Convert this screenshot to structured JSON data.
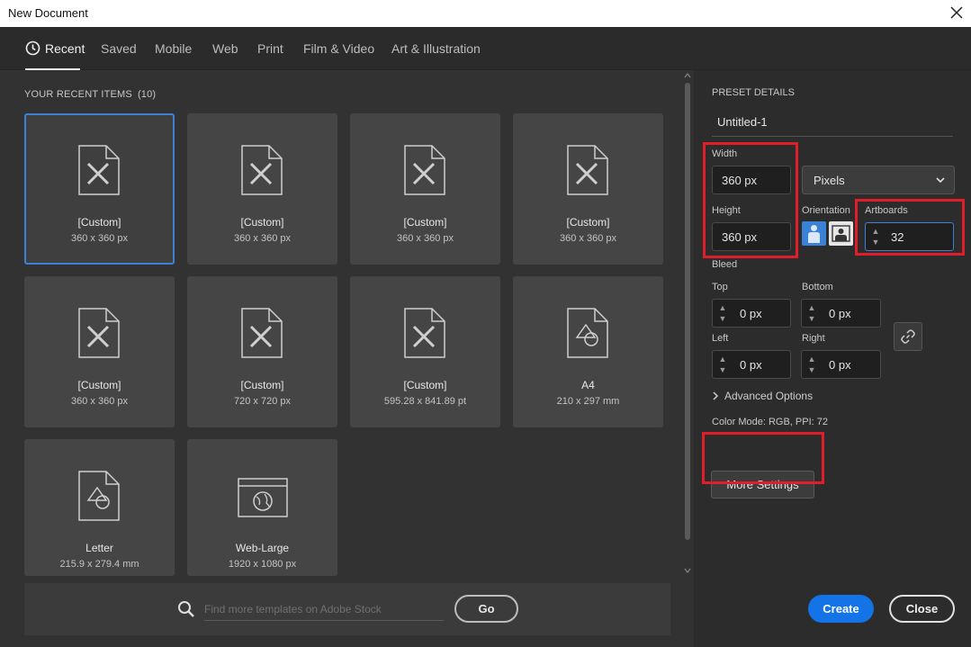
{
  "window": {
    "title": "New Document"
  },
  "tabs": [
    {
      "label": "Recent"
    },
    {
      "label": "Saved"
    },
    {
      "label": "Mobile"
    },
    {
      "label": "Web"
    },
    {
      "label": "Print"
    },
    {
      "label": "Film & Video"
    },
    {
      "label": "Art & Illustration"
    }
  ],
  "recent": {
    "heading": "YOUR RECENT ITEMS",
    "count": "(10)",
    "items": [
      {
        "name": "[Custom]",
        "size": "360 x 360 px",
        "icon": "custom-doc-icon"
      },
      {
        "name": "[Custom]",
        "size": "360 x 360 px",
        "icon": "custom-doc-icon"
      },
      {
        "name": "[Custom]",
        "size": "360 x 360 px",
        "icon": "custom-doc-icon"
      },
      {
        "name": "[Custom]",
        "size": "360 x 360 px",
        "icon": "custom-doc-icon"
      },
      {
        "name": "[Custom]",
        "size": "360 x 360 px",
        "icon": "custom-doc-icon"
      },
      {
        "name": "[Custom]",
        "size": "720 x 720 px",
        "icon": "custom-doc-icon"
      },
      {
        "name": "[Custom]",
        "size": "595.28 x 841.89 pt",
        "icon": "custom-doc-icon"
      },
      {
        "name": "A4",
        "size": "210 x 297 mm",
        "icon": "print-doc-icon"
      },
      {
        "name": "Letter",
        "size": "215.9 x 279.4 mm",
        "icon": "print-doc-icon"
      },
      {
        "name": "Web-Large",
        "size": "1920 x 1080 px",
        "icon": "web-doc-icon"
      }
    ]
  },
  "search": {
    "placeholder": "Find more templates on Adobe Stock",
    "go_label": "Go"
  },
  "preset": {
    "heading": "PRESET DETAILS",
    "name": "Untitled-1",
    "width_label": "Width",
    "width_value": "360 px",
    "units_value": "Pixels",
    "height_label": "Height",
    "height_value": "360 px",
    "orientation_label": "Orientation",
    "artboards_label": "Artboards",
    "artboards_value": "32",
    "bleed_label": "Bleed",
    "bleed_top_label": "Top",
    "bleed_top_value": "0 px",
    "bleed_bottom_label": "Bottom",
    "bleed_bottom_value": "0 px",
    "bleed_left_label": "Left",
    "bleed_left_value": "0 px",
    "bleed_right_label": "Right",
    "bleed_right_value": "0 px",
    "advanced_label": "Advanced Options",
    "color_mode": "Color Mode: RGB, PPI: 72",
    "more_settings_label": "More Settings",
    "create_label": "Create",
    "close_label": "Close"
  },
  "colors": {
    "accent": "#1473e6",
    "selection": "#3b82d6",
    "highlight": "#e01e2a",
    "panel": "#323232"
  }
}
